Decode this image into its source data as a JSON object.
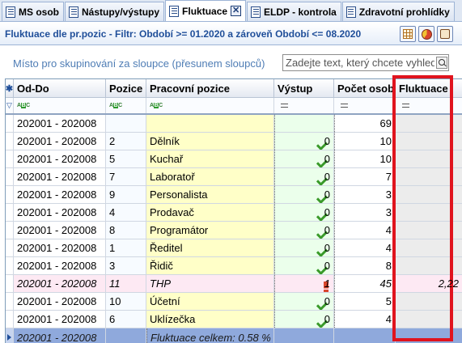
{
  "tabs": [
    {
      "label": "MS osob",
      "active": false
    },
    {
      "label": "Nástupy/výstupy",
      "active": false
    },
    {
      "label": "Fluktuace",
      "active": true
    },
    {
      "label": "ELDP - kontrola",
      "active": false
    },
    {
      "label": "Zdravotní prohlídky",
      "active": false
    }
  ],
  "view": {
    "title": "Fluktuace dle pr.pozic   -  Filtr: Období >= 01.2020  a zároveň  Období <= 08.2020"
  },
  "grouping_hint": "Místo pro skupinování za sloupce (přesunem sloupců)",
  "search": {
    "placeholder": "Zadejte text, který chcete vyhledat",
    "value": ""
  },
  "columns": [
    "Od-Do",
    "Pozice",
    "Pracovní pozice",
    "Výstup",
    "Počet osob",
    "Fluktuace"
  ],
  "rows": [
    {
      "od_do": "202001 - 202008",
      "pozice": "",
      "prac": "",
      "vystup": "",
      "pocet": "69",
      "pocet_frac": 1.0,
      "fluktuace": "",
      "flu_frac": 0,
      "check": false,
      "warn": false
    },
    {
      "od_do": "202001 - 202008",
      "pozice": "2",
      "prac": "Dělník",
      "vystup": "0",
      "pocet": "10",
      "pocet_frac": 0.14,
      "fluktuace": "",
      "flu_frac": 0,
      "check": true,
      "warn": false
    },
    {
      "od_do": "202001 - 202008",
      "pozice": "5",
      "prac": "Kuchař",
      "vystup": "0",
      "pocet": "10",
      "pocet_frac": 0.14,
      "fluktuace": "",
      "flu_frac": 0,
      "check": true,
      "warn": false
    },
    {
      "od_do": "202001 - 202008",
      "pozice": "7",
      "prac": "Laboratoř",
      "vystup": "0",
      "pocet": "7",
      "pocet_frac": 0.1,
      "fluktuace": "",
      "flu_frac": 0,
      "check": true,
      "warn": false
    },
    {
      "od_do": "202001 - 202008",
      "pozice": "9",
      "prac": "Personalista",
      "vystup": "0",
      "pocet": "3",
      "pocet_frac": 0.04,
      "fluktuace": "",
      "flu_frac": 0,
      "check": true,
      "warn": false
    },
    {
      "od_do": "202001 - 202008",
      "pozice": "4",
      "prac": "Prodavač",
      "vystup": "0",
      "pocet": "3",
      "pocet_frac": 0.04,
      "fluktuace": "",
      "flu_frac": 0,
      "check": true,
      "warn": false
    },
    {
      "od_do": "202001 - 202008",
      "pozice": "8",
      "prac": "Programátor",
      "vystup": "0",
      "pocet": "4",
      "pocet_frac": 0.06,
      "fluktuace": "",
      "flu_frac": 0,
      "check": true,
      "warn": false
    },
    {
      "od_do": "202001 - 202008",
      "pozice": "1",
      "prac": "Ředitel",
      "vystup": "0",
      "pocet": "4",
      "pocet_frac": 0.06,
      "fluktuace": "",
      "flu_frac": 0,
      "check": true,
      "warn": false
    },
    {
      "od_do": "202001 - 202008",
      "pozice": "3",
      "prac": "Řidič",
      "vystup": "0",
      "pocet": "8",
      "pocet_frac": 0.12,
      "fluktuace": "",
      "flu_frac": 0,
      "check": true,
      "warn": false
    },
    {
      "od_do": "202001 - 202008",
      "pozice": "11",
      "prac": "THP",
      "vystup": "1",
      "pocet": "45",
      "pocet_frac": 0.65,
      "fluktuace": "2,22",
      "flu_frac": 1.0,
      "check": false,
      "warn": true
    },
    {
      "od_do": "202001 - 202008",
      "pozice": "10",
      "prac": "Účetní",
      "vystup": "0",
      "pocet": "5",
      "pocet_frac": 0.07,
      "fluktuace": "",
      "flu_frac": 0,
      "check": true,
      "warn": false
    },
    {
      "od_do": "202001 - 202008",
      "pozice": "6",
      "prac": "Uklízečka",
      "vystup": "0",
      "pocet": "4",
      "pocet_frac": 0.06,
      "fluktuace": "",
      "flu_frac": 0,
      "check": true,
      "warn": false
    }
  ],
  "total": {
    "od_do": "202001 - 202008",
    "label": "Fluktuace celkem: 0.58 %"
  }
}
